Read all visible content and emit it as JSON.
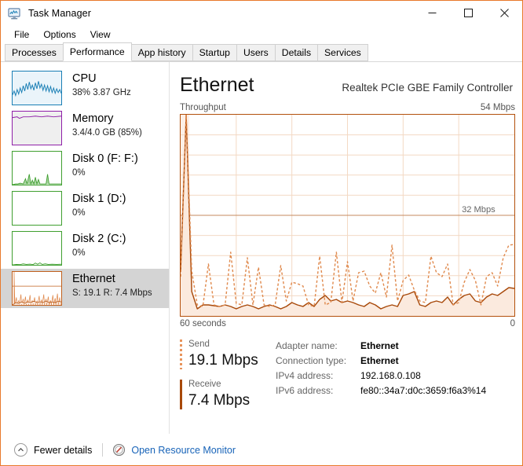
{
  "window": {
    "title": "Task Manager",
    "icon": "task-manager-icon",
    "controls": {
      "minimize": "minimize-icon",
      "maximize": "maximize-icon",
      "close": "close-icon"
    }
  },
  "menu": {
    "items": [
      "File",
      "Options",
      "View"
    ]
  },
  "tabs": {
    "items": [
      "Processes",
      "Performance",
      "App history",
      "Startup",
      "Users",
      "Details",
      "Services"
    ],
    "active": "Performance"
  },
  "sidebar": {
    "items": [
      {
        "name": "CPU",
        "detail": "38%  3.87 GHz",
        "color": "#1a7fb5",
        "fill": "#eaf4fa",
        "selected": false,
        "graph": "cpu"
      },
      {
        "name": "Memory",
        "detail": "3.4/4.0 GB (85%)",
        "color": "#8f1fa8",
        "fill": "#efefef",
        "selected": false,
        "graph": "memory"
      },
      {
        "name": "Disk 0 (F: F:)",
        "detail": "0%",
        "color": "#3f9f2f",
        "fill": "#ffffff",
        "selected": false,
        "graph": "disk0"
      },
      {
        "name": "Disk 1 (D:)",
        "detail": "0%",
        "color": "#3f9f2f",
        "fill": "#ffffff",
        "selected": false,
        "graph": "disk1"
      },
      {
        "name": "Disk 2 (C:)",
        "detail": "0%",
        "color": "#3f9f2f",
        "fill": "#ffffff",
        "selected": false,
        "graph": "disk2"
      },
      {
        "name": "Ethernet",
        "detail": "S: 19.1 R: 7.4 Mbps",
        "color": "#c1601c",
        "fill": "#ffffff",
        "selected": true,
        "graph": "ethernet"
      }
    ]
  },
  "main": {
    "title": "Ethernet",
    "adapter_title": "Realtek PCIe GBE Family Controller",
    "chart_top_left_label": "Throughput",
    "chart_top_right_label": "54 Mbps",
    "chart_bottom_left_label": "60 seconds",
    "chart_bottom_right_label": "0",
    "inline_reference_label": "32 Mbps",
    "stats": [
      {
        "label": "Send",
        "value": "19.1 Mbps",
        "style": "send"
      },
      {
        "label": "Receive",
        "value": "7.4 Mbps",
        "style": "recv"
      }
    ],
    "info": [
      {
        "key": "Adapter name:",
        "value": "Ethernet",
        "bold": true
      },
      {
        "key": "Connection type:",
        "value": "Ethernet",
        "bold": true
      },
      {
        "key": "IPv4 address:",
        "value": "192.168.0.108",
        "bold": false
      },
      {
        "key": "IPv6 address:",
        "value": "fe80::34a7:d0c:3659:f6a3%14",
        "bold": false
      }
    ]
  },
  "statusbar": {
    "fewer_details": "Fewer details",
    "fewer_icon": "chevron-up-circle-icon",
    "resource_monitor": "Open Resource Monitor",
    "resource_monitor_icon": "resource-monitor-icon"
  },
  "colors": {
    "accent_border": "#e8792b",
    "chart_border": "#b3500c",
    "send_line": "#e08a4e",
    "receive_line": "#a8490a",
    "receive_fill": "#fbeade",
    "grid": "#f3d9c4",
    "link": "#1763b8",
    "selection": "#d4d4d4"
  },
  "chart_data": {
    "type": "line",
    "title": "Throughput",
    "xlabel": "60 seconds",
    "ylabel": "Mbps",
    "ylim": [
      0,
      54
    ],
    "xlim": [
      60,
      0
    ],
    "grid": true,
    "grid_rows": 10,
    "grid_cols": 6,
    "axis_labels": {
      "top_left": "Throughput",
      "top_right": "54 Mbps",
      "bottom_left": "60 seconds",
      "bottom_right": "0"
    },
    "annotations": [
      {
        "text": "32 Mbps",
        "y": 32,
        "type": "horizontal-reference-line"
      }
    ],
    "series": [
      {
        "name": "Send",
        "color": "#e08a4e",
        "style": "dashed",
        "values": [
          10.5,
          54,
          12,
          3,
          2.5,
          14,
          3,
          2.5,
          3,
          17,
          3.5,
          3,
          15.5,
          3,
          13,
          3,
          2.5,
          3,
          13.5,
          4,
          9,
          8.5,
          8,
          3,
          2.5,
          16,
          3,
          3.5,
          17,
          3.5,
          14.5,
          4,
          11.5,
          12,
          8,
          6,
          11.5,
          5,
          19,
          4,
          9.5,
          11,
          7,
          4,
          3.5,
          16,
          11.5,
          10.5,
          14,
          3,
          3.5,
          9,
          12.5,
          9.5,
          3,
          10.5,
          11.5,
          8,
          15.5,
          19.1
        ]
      },
      {
        "name": "Receive",
        "color": "#a8490a",
        "style": "solid",
        "fill": "#fbeade",
        "values": [
          12,
          54,
          6.5,
          2,
          3,
          3,
          2.8,
          2.5,
          3,
          2.5,
          2,
          2.5,
          3,
          2.5,
          2,
          2.5,
          3,
          2.5,
          2,
          2.5,
          3.5,
          3,
          2.5,
          3.5,
          2.5,
          4.5,
          5.5,
          4,
          4.5,
          3.5,
          4,
          3.5,
          3,
          2.5,
          3.5,
          3,
          2,
          2.5,
          3,
          2.5,
          5.5,
          6,
          6.5,
          3,
          2.5,
          3.5,
          4,
          3.5,
          5,
          3,
          4.5,
          5.5,
          6,
          4,
          3.5,
          5,
          6,
          5.5,
          6.5,
          7.4
        ]
      }
    ]
  }
}
